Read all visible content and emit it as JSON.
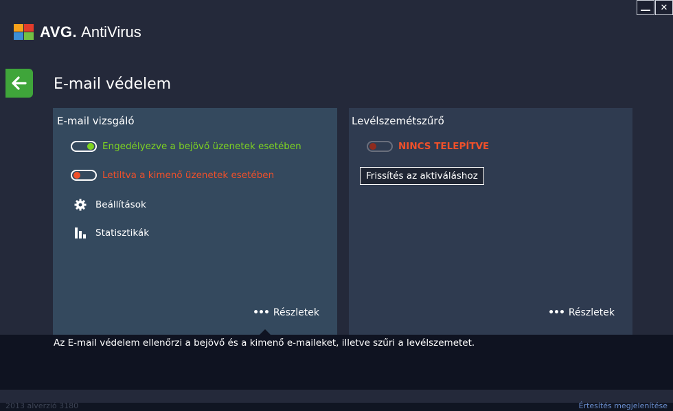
{
  "app": {
    "brand": "AVG.",
    "name": "AntiVirus"
  },
  "page": {
    "title": "E-mail védelem"
  },
  "left_panel": {
    "title": "E-mail vizsgáló",
    "incoming": {
      "label": "Engedélyezve a bejövő üzenetek esetében",
      "enabled": true,
      "color": "#7ed321"
    },
    "outgoing": {
      "label": "Letiltva a kimenő üzenetek esetében",
      "enabled": false,
      "color": "#f0502a"
    },
    "menu": [
      {
        "label": "Beállítások",
        "icon": "gear-icon"
      },
      {
        "label": "Statisztikák",
        "icon": "bar-chart-icon"
      }
    ],
    "details_label": "Részletek"
  },
  "right_panel": {
    "title": "Levélszemétszűrő",
    "status": {
      "label": "NINCS TELEPÍTVE",
      "color": "#f0502a"
    },
    "upgrade_label": "Frissítés az aktiváláshoz",
    "details_label": "Részletek"
  },
  "info": {
    "text": "Az E-mail védelem ellenőrzi a bejövő és a kimenő e-maileket, illetve szűri a levélszemetet."
  },
  "footer": {
    "version": "2013  alverzió 3180",
    "notifications": "Értesítés megjelenítése"
  },
  "colors": {
    "background": "#24293a",
    "panel": "#34495e",
    "accent_green": "#3fa53a"
  }
}
